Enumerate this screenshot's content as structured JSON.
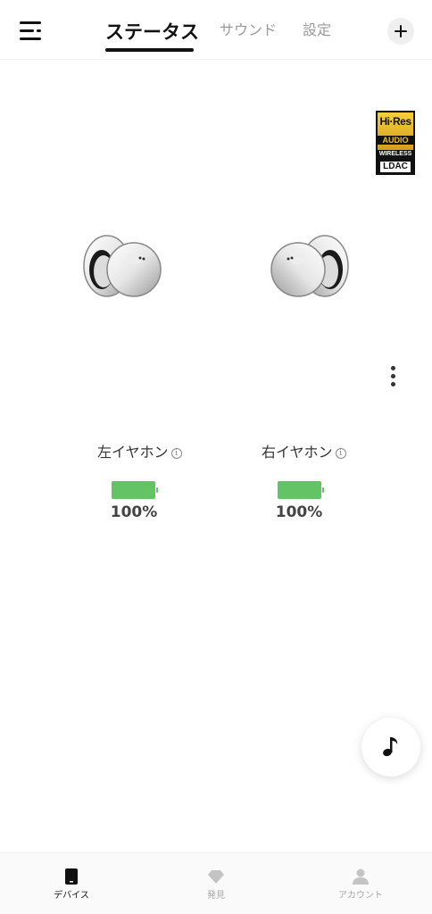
{
  "header": {
    "tabs": [
      {
        "label": "ステータス",
        "active": true
      },
      {
        "label": "サウンド",
        "active": false
      },
      {
        "label": "設定",
        "active": false
      }
    ]
  },
  "badge": {
    "hires": "Hi·Res",
    "audio": "AUDIO",
    "wireless": "WIRELESS",
    "ldac": "LDAC"
  },
  "earbuds": {
    "left": {
      "label": "左イヤホン",
      "battery_percent_text": "100%",
      "battery_level": 1.0
    },
    "right": {
      "label": "右イヤホン",
      "battery_percent_text": "100%",
      "battery_level": 1.0
    }
  },
  "info_icon": "i",
  "colors": {
    "battery": "#62c463",
    "active_tab": "#111111",
    "inactive_tab": "#9a9a9a",
    "badge_gold": "#f0c030"
  },
  "icons": {
    "menu": "menu-icon",
    "add": "plus-icon",
    "more": "more-vertical-icon",
    "music": "music-note-icon",
    "devices": "device-icon",
    "discover": "diamond-icon",
    "account": "person-icon"
  },
  "bottom_nav": {
    "items": [
      {
        "label": "デバイス",
        "active": true
      },
      {
        "label": "発見",
        "active": false
      },
      {
        "label": "アカウント",
        "active": false
      }
    ]
  }
}
